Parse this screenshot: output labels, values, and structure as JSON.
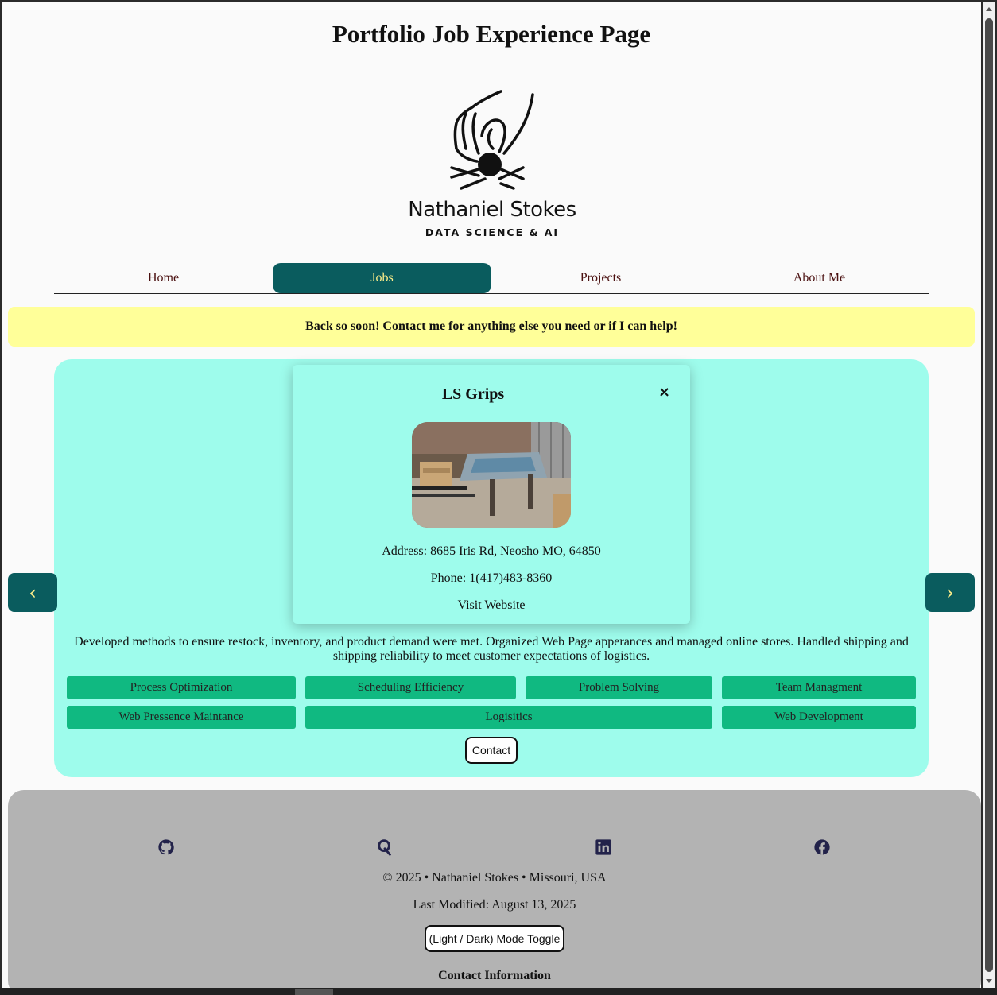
{
  "page": {
    "title": "Portfolio Job Experience Page"
  },
  "logo": {
    "name": "Nathaniel Stokes",
    "subtitle": "DATA SCIENCE & AI"
  },
  "nav": {
    "items": [
      {
        "label": "Home",
        "active": false
      },
      {
        "label": "Jobs",
        "active": true
      },
      {
        "label": "Projects",
        "active": false
      },
      {
        "label": "About Me",
        "active": false
      }
    ]
  },
  "banner": {
    "text": "Back so soon! Contact me for anything else you need or if I can help!"
  },
  "carousel": {
    "prev_label": "‹",
    "next_label": "›"
  },
  "popup": {
    "title": "LS Grips",
    "close_label": "×",
    "address_prefix": "Address: ",
    "address": "8685 Iris Rd, Neosho MO, 64850",
    "phone_prefix": "Phone: ",
    "phone": "1(417)483-8360",
    "website_label": "Visit Website"
  },
  "job": {
    "description": "Developed methods to ensure restock, inventory, and product demand were met. Organized Web Page apperances and managed online stores. Handled shipping and shipping reliability to meet customer expectations of logistics.",
    "skills": [
      "Process Optimization",
      "Scheduling Efficiency",
      "Problem Solving",
      "Team Managment",
      "Web Pressence Maintance",
      "Logisitics",
      "Web Development"
    ],
    "contact_label": "Contact"
  },
  "footer": {
    "social_icons": [
      "github-icon",
      "quora-icon",
      "linkedin-icon",
      "facebook-icon"
    ],
    "copyright": "© 2025 • Nathaniel Stokes • Missouri, USA",
    "last_modified": "Last Modified: August 13, 2025",
    "mode_toggle_label": "(Light / Dark) Mode Toggle",
    "contact_heading": "Contact Information"
  },
  "colors": {
    "accent": "#0a5c5e",
    "accent_text": "#ffef8a",
    "banner": "#ffff99",
    "card": "#9efcec",
    "skill": "#10b981",
    "footer": "#b3b3b3",
    "social": "#22224a"
  }
}
